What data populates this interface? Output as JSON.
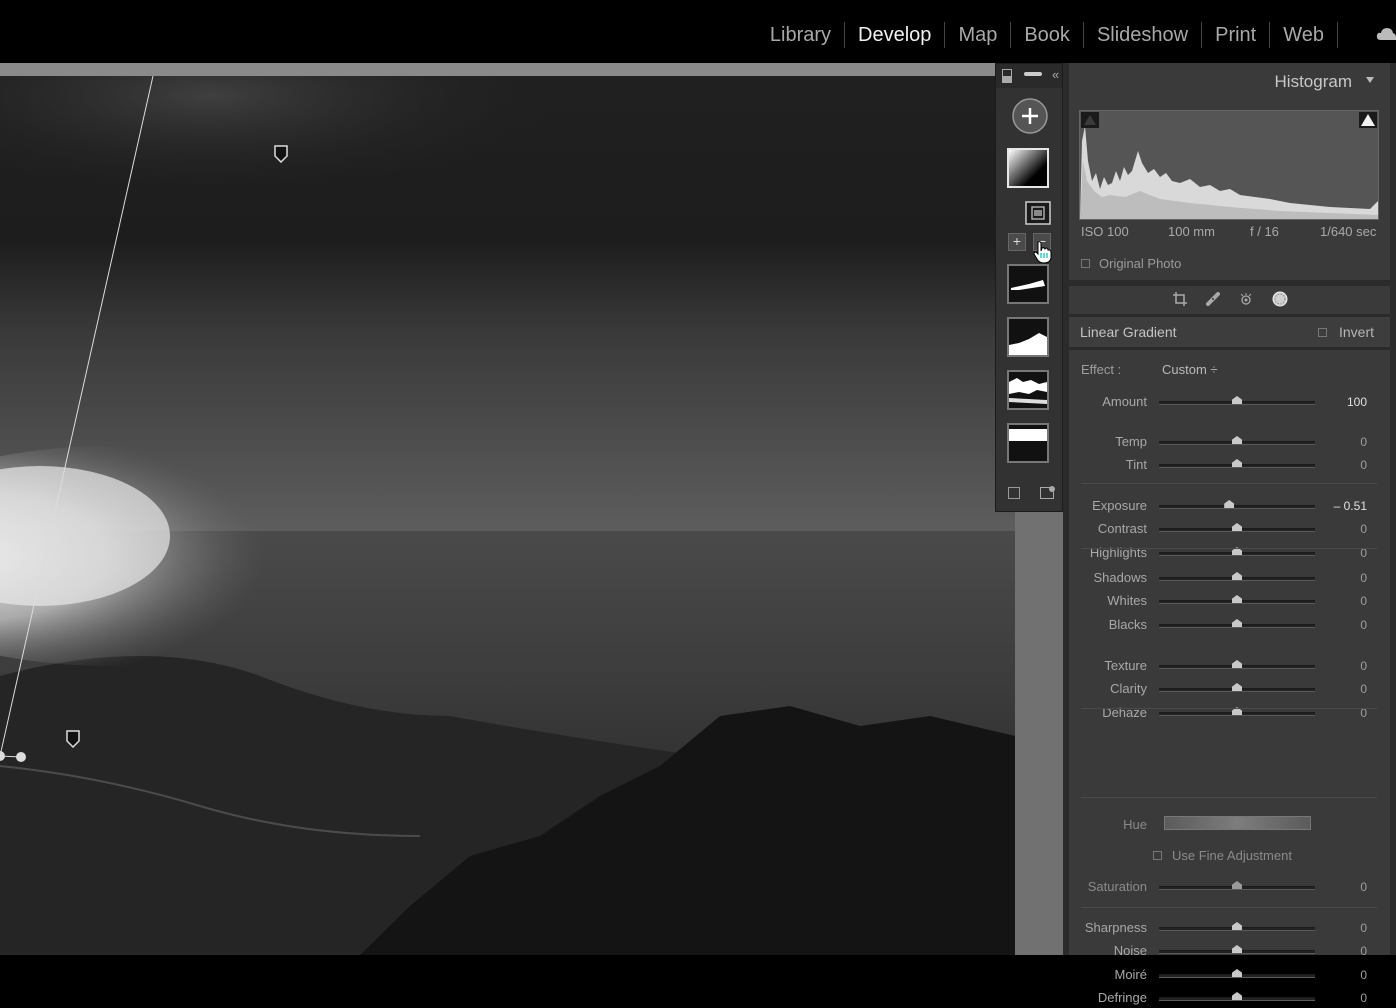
{
  "modules": [
    "Library",
    "Develop",
    "Map",
    "Book",
    "Slideshow",
    "Print",
    "Web"
  ],
  "active_module": "Develop",
  "histogram": {
    "title": "Histogram",
    "exif": {
      "iso": "ISO 100",
      "focal": "100 mm",
      "aperture": "f / 16",
      "shutter": "1/640 sec"
    },
    "original_photo": "Original Photo"
  },
  "mask": {
    "title": "Linear Gradient",
    "invert": "Invert"
  },
  "effect": {
    "label": "Effect :",
    "value": "Custom ÷"
  },
  "sliders": [
    {
      "label": "Amount",
      "value": "100",
      "pos": 0.5
    },
    {
      "label": "Temp",
      "value": "0",
      "pos": 0.5
    },
    {
      "label": "Tint",
      "value": "0",
      "pos": 0.5
    },
    {
      "label": "Exposure",
      "value": "– 0.51",
      "pos": 0.45
    },
    {
      "label": "Contrast",
      "value": "0",
      "pos": 0.5
    },
    {
      "label": "Highlights",
      "value": "0",
      "pos": 0.5
    },
    {
      "label": "Shadows",
      "value": "0",
      "pos": 0.5
    },
    {
      "label": "Whites",
      "value": "0",
      "pos": 0.5
    },
    {
      "label": "Blacks",
      "value": "0",
      "pos": 0.5
    },
    {
      "label": "Texture",
      "value": "0",
      "pos": 0.5
    },
    {
      "label": "Clarity",
      "value": "0",
      "pos": 0.5
    },
    {
      "label": "Dehaze",
      "value": "0",
      "pos": 0.5
    },
    {
      "label": "Saturation",
      "value": "0",
      "pos": 0.5
    },
    {
      "label": "Sharpness",
      "value": "0",
      "pos": 0.5
    },
    {
      "label": "Noise",
      "value": "0",
      "pos": 0.5
    },
    {
      "label": "Moiré",
      "value": "0",
      "pos": 0.5
    },
    {
      "label": "Defringe",
      "value": "0",
      "pos": 0.5
    }
  ],
  "hue_label": "Hue",
  "fine_adjustment": "Use Fine Adjustment"
}
